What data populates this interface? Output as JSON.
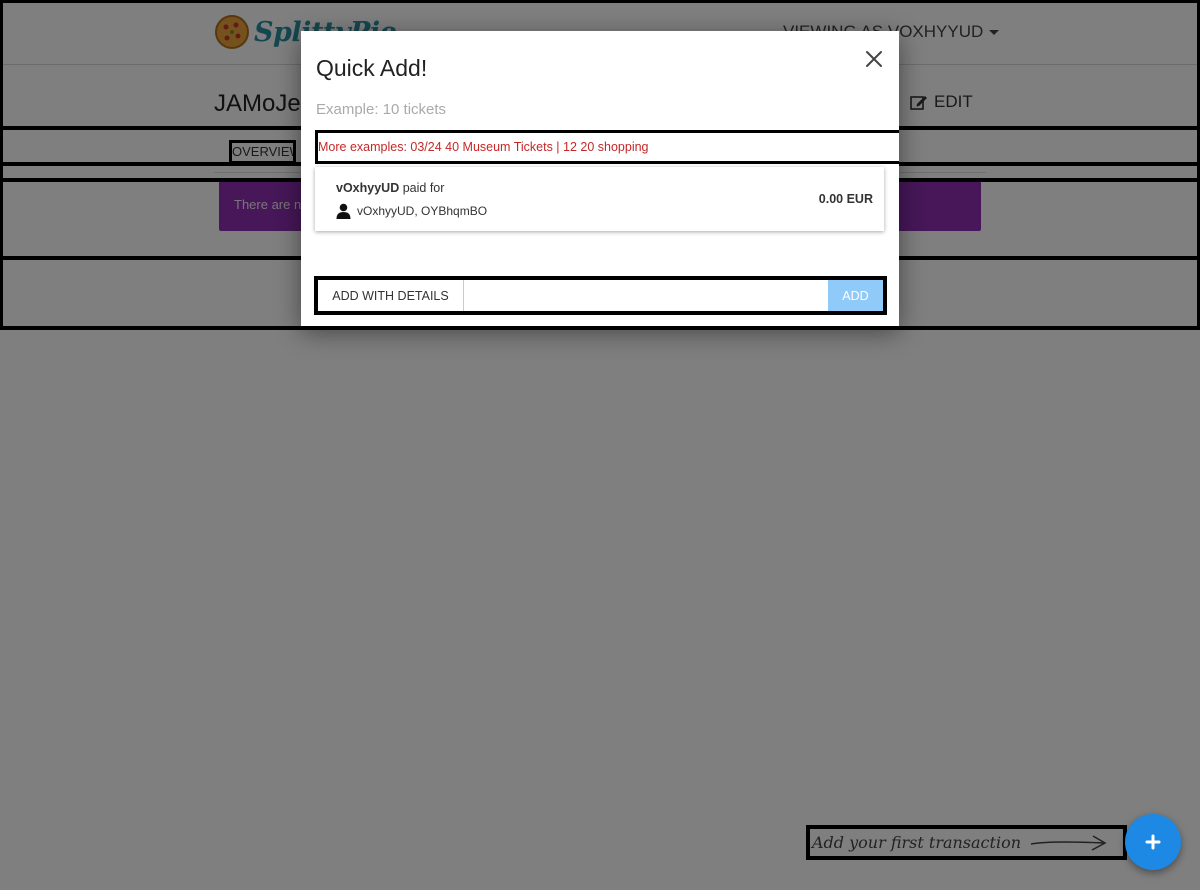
{
  "header": {
    "logo_text": "SplittyPie",
    "viewing_as": "VIEWING AS VOXHYYUD"
  },
  "group": {
    "title": "JAMoJe",
    "edit_label": "EDIT"
  },
  "tabs": [
    {
      "label": "OVERVIEW"
    }
  ],
  "banner": {
    "text": "There are no transactions yet."
  },
  "modal": {
    "title": "Quick Add!",
    "example": "Example: 10 tickets",
    "more_examples": "More examples: 03/24 40 Museum Tickets | 12 20 shopping",
    "preview": {
      "payer": "vOxhyyUD",
      "paid_for_text": " paid for",
      "participants": "vOxhyyUD, OYBhqmBO",
      "amount": "0.00 EUR"
    },
    "add_details_label": "ADD WITH DETAILS",
    "input_value": "",
    "input_placeholder": "",
    "add_label": "ADD"
  },
  "hint": {
    "text": "Add your first transaction"
  },
  "colors": {
    "banner": "#8e2fb3",
    "fab": "#1e88e5",
    "add_button": "#90caf9",
    "error_text": "#c62828",
    "logo": "#2a8fa0"
  },
  "icons": {
    "logo": "pie-logo-icon",
    "caret": "caret-down-icon",
    "edit": "edit-icon",
    "close": "close-icon",
    "user": "user-icon",
    "arrow": "arrow-right-icon",
    "plus": "plus-icon"
  }
}
